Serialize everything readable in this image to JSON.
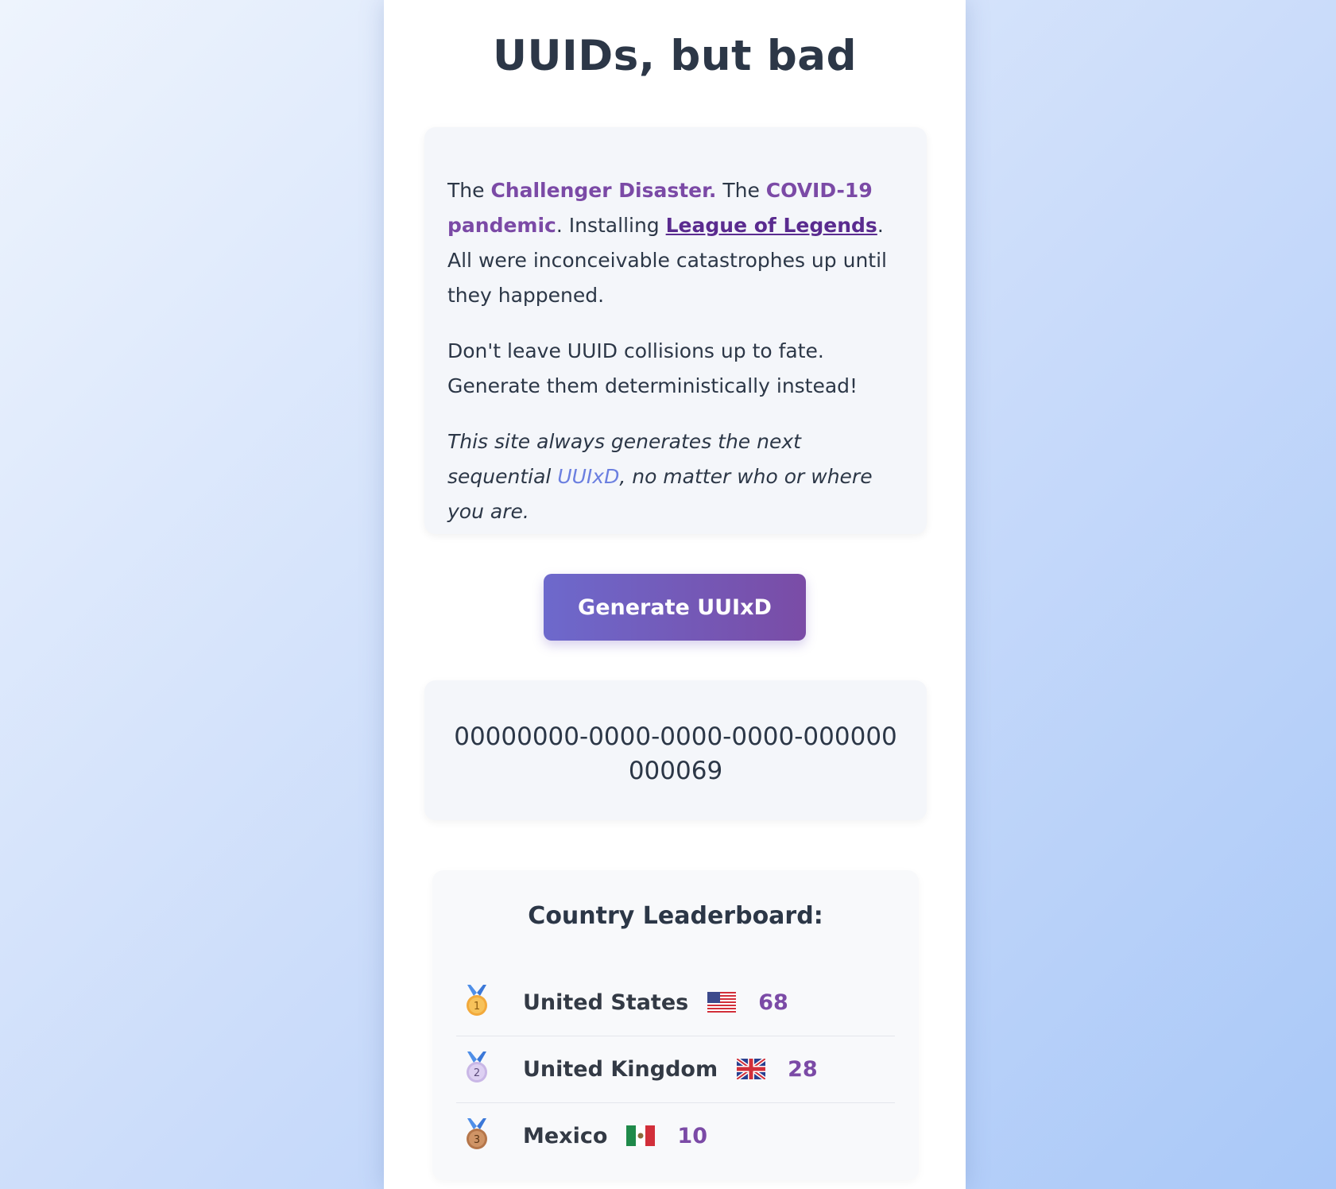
{
  "page": {
    "title": "UUIDs, but bad"
  },
  "intro": {
    "p1": {
      "the1": "The ",
      "challenger": "Challenger Disaster.",
      "the2": " The ",
      "covid": "COVID-19 pandemic",
      "installing": ". Installing ",
      "league": "League of Legends",
      "rest": ". All were inconceivable catastrophes up until they happened."
    },
    "p2": "Don't leave UUID collisions up to fate. Generate them deterministically instead!",
    "p3": {
      "before": "This site always generates the next sequential ",
      "uuixd": "UUIxD",
      "after": ", no matter who or where you are."
    }
  },
  "generate_button": {
    "label": "Generate UUIxD"
  },
  "uuid": {
    "value": "00000000-0000-0000-0000-000000000069"
  },
  "leaderboard": {
    "title": "Country Leaderboard:",
    "entries": [
      {
        "rank": "1",
        "medal": "gold-medal-icon",
        "country": "United States",
        "flag": "us-flag-icon",
        "count": "68"
      },
      {
        "rank": "2",
        "medal": "silver-medal-icon",
        "country": "United Kingdom",
        "flag": "uk-flag-icon",
        "count": "28"
      },
      {
        "rank": "3",
        "medal": "bronze-medal-icon",
        "country": "Mexico",
        "flag": "mexico-flag-icon",
        "count": "10"
      }
    ]
  },
  "colors": {
    "accent": "#7b4aa6",
    "button_start": "#6d69cc",
    "button_end": "#7a4ca6",
    "uuixd_link": "#6b7fe0"
  }
}
